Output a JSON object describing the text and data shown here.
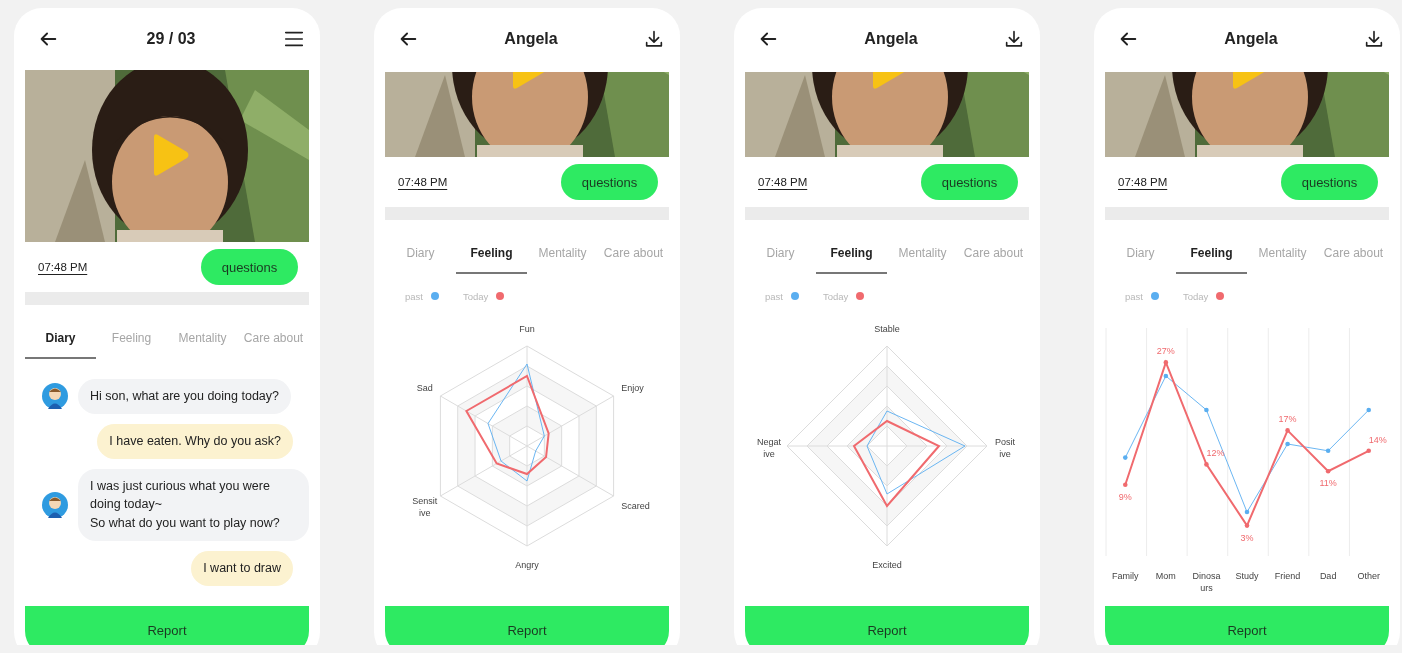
{
  "screens": [
    {
      "kind": "diary",
      "title": "29 / 03",
      "time": "07:48 PM",
      "questions_button": "questions",
      "tabs": [
        {
          "label": "Diary",
          "selected": true
        },
        {
          "label": "Feeling",
          "selected": false
        },
        {
          "label": "Mentality",
          "selected": false
        },
        {
          "label": "Care about",
          "selected": false
        }
      ],
      "messages": [
        {
          "text": "Hi son, what are you doing today?",
          "incoming": true
        },
        {
          "text": "I have eaten. Why do you ask?",
          "incoming": false
        },
        {
          "text": "I was just curious what you were doing today~\nSo what do you want to play now?",
          "incoming": true
        },
        {
          "text": "I want to draw",
          "incoming": false
        }
      ],
      "report_button": "Report"
    },
    {
      "kind": "radar",
      "title": "Angela",
      "time": "07:48 PM",
      "questions_button": "questions",
      "tabs": [
        {
          "label": "Diary",
          "selected": false
        },
        {
          "label": "Feeling",
          "selected": true
        },
        {
          "label": "Mentality",
          "selected": false
        },
        {
          "label": "Care about",
          "selected": false
        }
      ],
      "legend": [
        {
          "label": "past",
          "color": "#5aaef0"
        },
        {
          "label": "Today",
          "color": "#f06a6e"
        }
      ],
      "axes": [
        "Fun",
        "Enjoy",
        "Scared",
        "Angry",
        "Sensit\nive",
        "Sad"
      ],
      "report_button": "Report"
    },
    {
      "kind": "radar",
      "title": "Angela",
      "time": "07:48 PM",
      "questions_button": "questions",
      "tabs": [
        {
          "label": "Diary",
          "selected": false
        },
        {
          "label": "Feeling",
          "selected": true
        },
        {
          "label": "Mentality",
          "selected": false
        },
        {
          "label": "Care about",
          "selected": false
        }
      ],
      "legend": [
        {
          "label": "past",
          "color": "#5aaef0"
        },
        {
          "label": "Today",
          "color": "#f06a6e"
        }
      ],
      "axes": [
        "Stable",
        "Posit\nive",
        "Excited",
        "Negat\nive"
      ],
      "report_button": "Report"
    },
    {
      "kind": "line",
      "title": "Angela",
      "time": "07:48 PM",
      "questions_button": "questions",
      "tabs": [
        {
          "label": "Diary",
          "selected": false
        },
        {
          "label": "Feeling",
          "selected": true
        },
        {
          "label": "Mentality",
          "selected": false
        },
        {
          "label": "Care about",
          "selected": false
        }
      ],
      "legend": [
        {
          "label": "past",
          "color": "#5aaef0"
        },
        {
          "label": "Today",
          "color": "#f06a6e"
        }
      ],
      "categories": [
        "Family",
        "Mom",
        "Dinosa\nurs",
        "Study",
        "Friend",
        "Dad",
        "Other"
      ],
      "today_labels": [
        "9%",
        "27%",
        "12%",
        "3%",
        "17%",
        "11%",
        "14%"
      ],
      "report_button": "Report"
    }
  ]
}
